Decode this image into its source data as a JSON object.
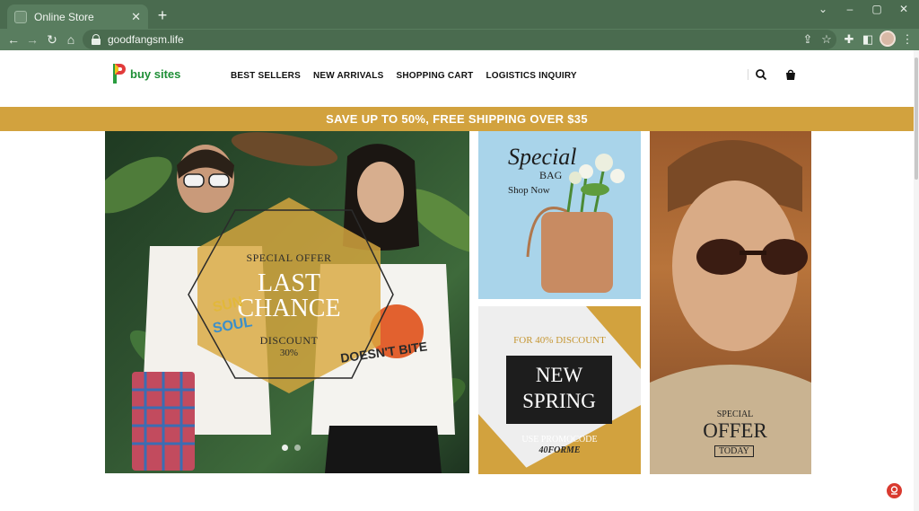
{
  "browser": {
    "tab_title": "Online Store",
    "url": "goodfangsm.life"
  },
  "site": {
    "logo_text": "buy sites",
    "nav": [
      "BEST SELLERS",
      "NEW ARRIVALS",
      "SHOPPING CART",
      "LOGISTICS INQUIRY"
    ],
    "promo_bar": "SAVE UP TO 50%, FREE SHIPPING OVER $35"
  },
  "banners": {
    "main": {
      "kicker": "SPECIAL OFFER",
      "headline_1": "LAST",
      "headline_2": "CHANCE",
      "discount_label": "DISCOUNT",
      "discount_value": "30%",
      "shirt_text_1": "SUN",
      "shirt_text_2": "SOUL",
      "shirt_text_3": "DOESN'T BITE"
    },
    "bag": {
      "title": "Special",
      "subtitle": "BAG",
      "cta": "Shop Now"
    },
    "spring": {
      "discount": "FOR 40% DISCOUNT",
      "headline_1": "NEW",
      "headline_2": "SPRING",
      "promo_label": "USE PROMOCODE",
      "promo_code": "40FORME"
    },
    "offer": {
      "kicker": "SPECIAL",
      "headline": "OFFER",
      "tag": "TODAY"
    }
  },
  "colors": {
    "tab_bar": "#4a6b4f",
    "toolbar": "#597d5f",
    "promo_gold": "#d2a23e"
  }
}
